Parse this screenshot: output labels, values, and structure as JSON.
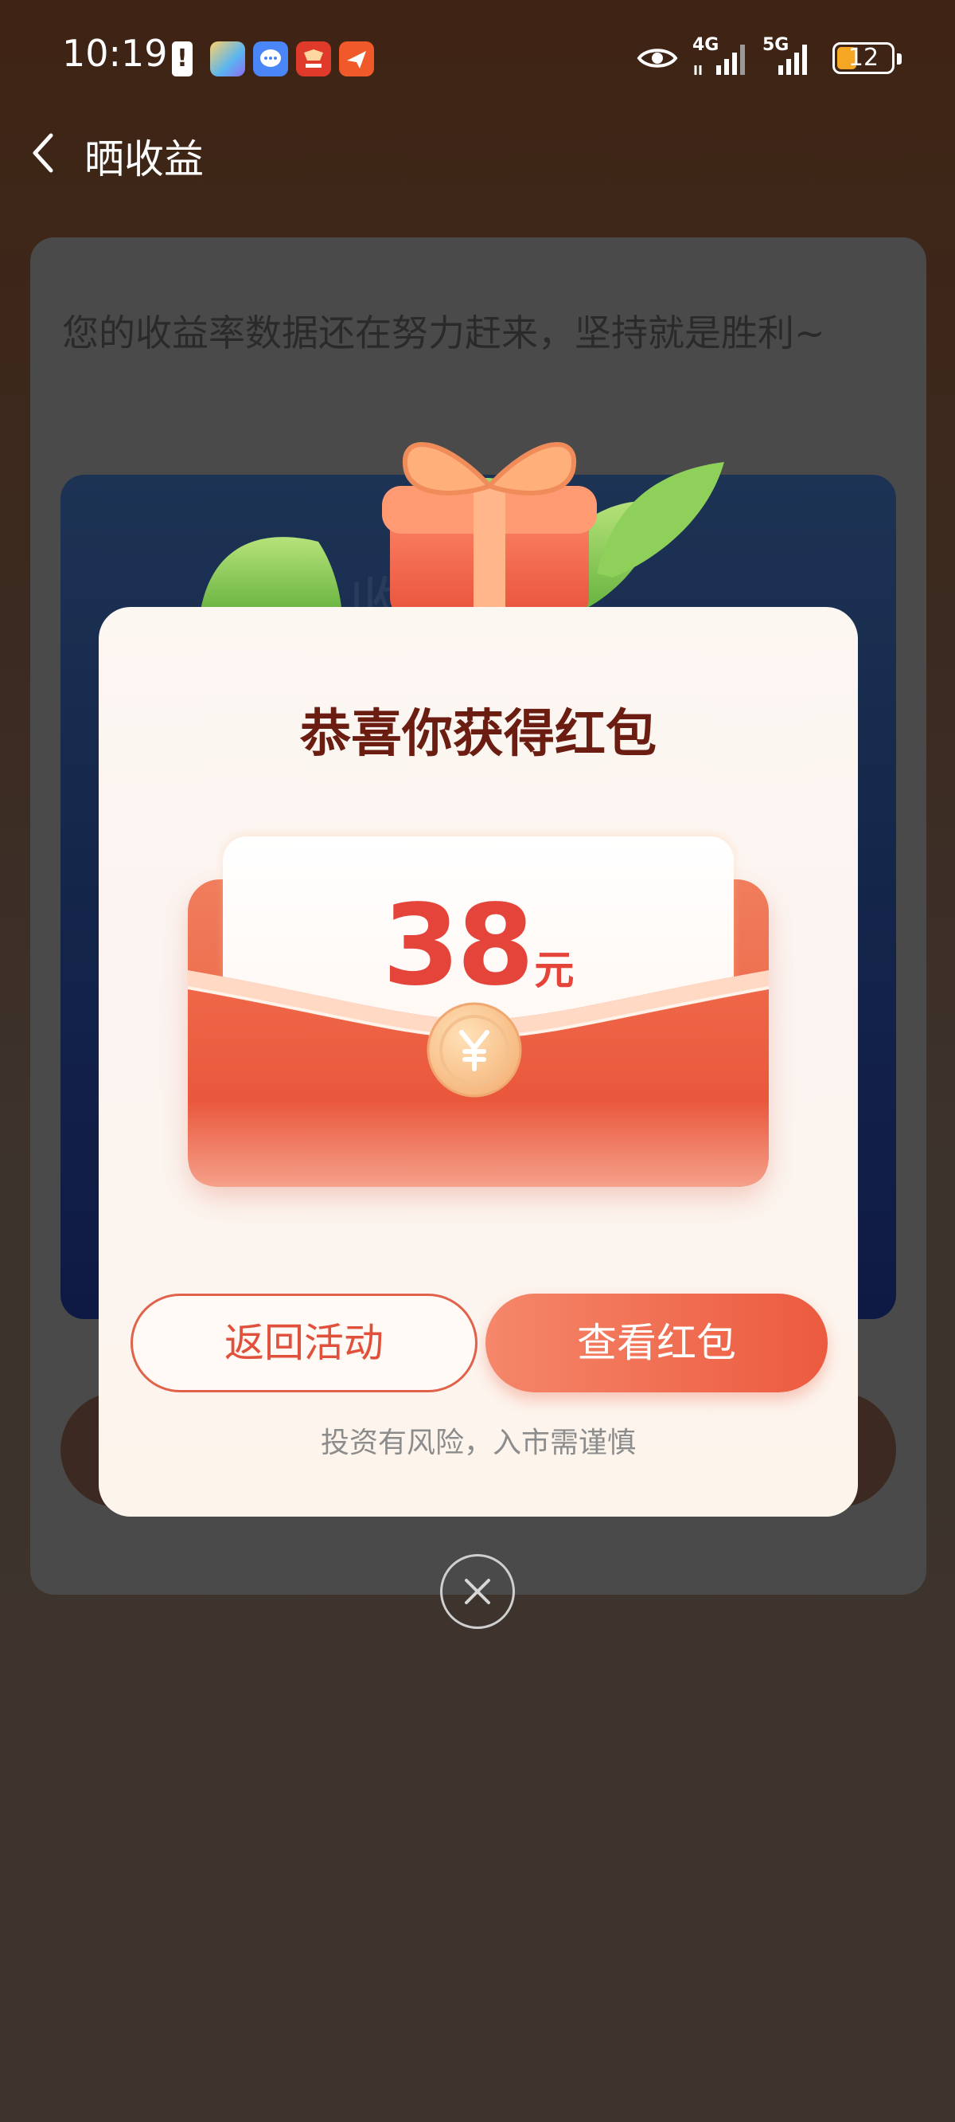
{
  "status_bar": {
    "time": "10:19",
    "network_1": "4G",
    "network_2": "5G",
    "battery": "12",
    "app_icons": [
      "game-center-icon",
      "messages-icon",
      "citic-securities-icon",
      "paper-plane-app-icon"
    ]
  },
  "nav": {
    "title": "晒收益"
  },
  "background": {
    "message": "您的收益率数据还在努力赶来，坚持就是胜利~",
    "inner_heading": "收益 厉"
  },
  "modal": {
    "title": "恭喜你获得红包",
    "amount": "38",
    "unit": "元",
    "back_button": "返回活动",
    "view_button": "查看红包",
    "risk_notice": "投资有风险，入市需谨慎"
  },
  "colors": {
    "accent": "#e5443a",
    "title": "#6b1d12",
    "button_gradient_start": "#f5876a",
    "button_gradient_end": "#ec5a3f"
  }
}
